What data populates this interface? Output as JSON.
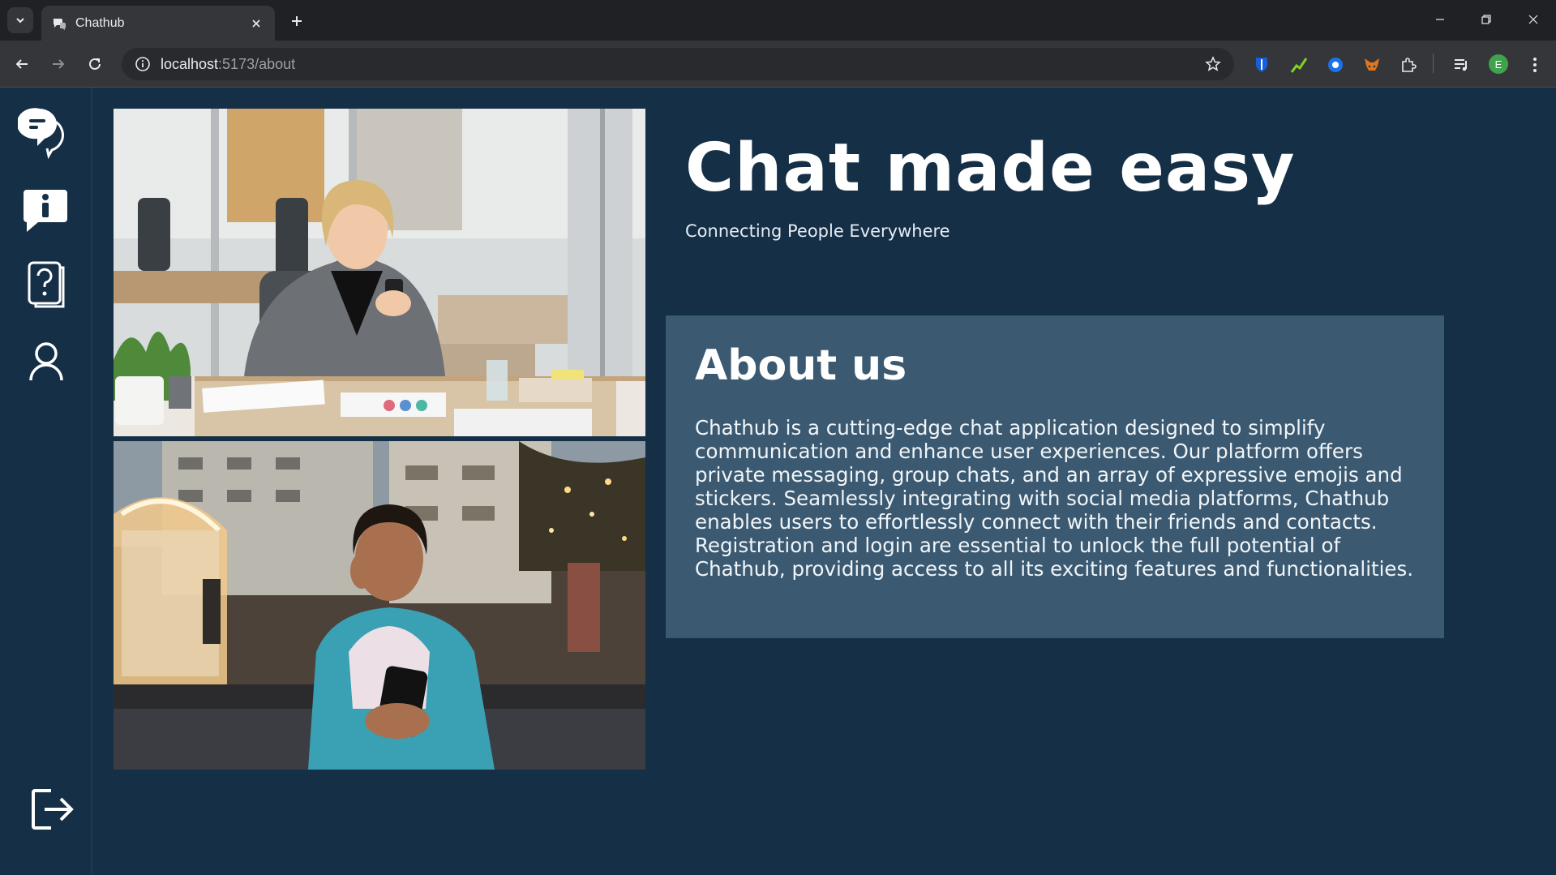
{
  "browser": {
    "tab_title": "Chathub",
    "url_host": "localhost",
    "url_path": ":5173/about",
    "profile_initial": "E"
  },
  "sidebar": {
    "items": [
      {
        "icon": "chat-bubbles-icon"
      },
      {
        "icon": "info-bubble-icon"
      },
      {
        "icon": "help-question-icon"
      },
      {
        "icon": "user-profile-icon"
      }
    ],
    "logout_icon": "logout-icon"
  },
  "hero": {
    "title": "Chat made easy",
    "subtitle": "Connecting People Everywhere"
  },
  "about": {
    "title": "About us",
    "body": "Chathub is a cutting-edge chat application designed to simplify communication and enhance user experiences. Our platform offers private messaging, group chats, and an array of expressive emojis and stickers. Seamlessly integrating with social media platforms, Chathub enables users to effortlessly connect with their friends and contacts. Registration and login are essential to unlock the full potential of Chathub, providing access to all its exciting features and functionalities."
  },
  "colors": {
    "page_bg": "#142f46",
    "card_bg": "#3b5a72",
    "text": "#ffffff"
  }
}
